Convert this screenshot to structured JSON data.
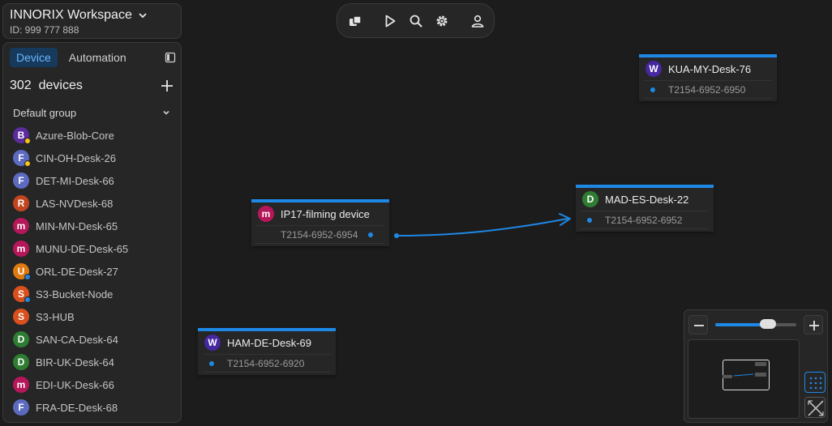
{
  "workspace": {
    "title": "INNORIX Workspace",
    "id_label": "ID: 999 777 888"
  },
  "sidebar": {
    "tabs": [
      {
        "label": "Device",
        "active": true
      },
      {
        "label": "Automation",
        "active": false
      }
    ],
    "devices_count_label": "302  devices",
    "group_label": "Default group",
    "devices": [
      {
        "letter": "B",
        "name": "Azure-Blob-Core",
        "color": "#5b2c9f",
        "status": "#f5c518"
      },
      {
        "letter": "F",
        "name": "CIN-OH-Desk-26",
        "color": "#5c6bc0",
        "status": "#f5c518"
      },
      {
        "letter": "F",
        "name": "DET-MI-Desk-66",
        "color": "#5c6bc0",
        "status": ""
      },
      {
        "letter": "R",
        "name": "LAS-NVDesk-68",
        "color": "#c1451f",
        "status": ""
      },
      {
        "letter": "m",
        "name": "MIN-MN-Desk-65",
        "color": "#b5175a",
        "status": ""
      },
      {
        "letter": "m",
        "name": "MUNU-DE-Desk-65",
        "color": "#b5175a",
        "status": ""
      },
      {
        "letter": "U",
        "name": "ORL-DE-Desk-27",
        "color": "#e07a10",
        "status": "#1e88e5"
      },
      {
        "letter": "S",
        "name": "S3-Bucket-Node",
        "color": "#d9501e",
        "status": "#1e88e5"
      },
      {
        "letter": "S",
        "name": "S3-HUB",
        "color": "#d9501e",
        "status": ""
      },
      {
        "letter": "D",
        "name": "SAN-CA-Desk-64",
        "color": "#2e7d32",
        "status": ""
      },
      {
        "letter": "D",
        "name": "BIR-UK-Desk-64",
        "color": "#2e7d32",
        "status": ""
      },
      {
        "letter": "m",
        "name": "EDI-UK-Desk-66",
        "color": "#b5175a",
        "status": ""
      },
      {
        "letter": "F",
        "name": "FRA-DE-Desk-68",
        "color": "#5c6bc0",
        "status": ""
      }
    ]
  },
  "toolbar": {
    "icons": [
      "layers-icon",
      "play-icon",
      "search-icon",
      "gear-icon",
      "user-icon"
    ]
  },
  "nodes": {
    "kua": {
      "letter": "W",
      "title": "KUA-MY-Desk-76",
      "port": "T2154-6952-6950",
      "color": "#4527a0"
    },
    "ip17": {
      "letter": "m",
      "title": "IP17-filming device",
      "port": "T2154-6952-6954",
      "color": "#b5175a"
    },
    "mad": {
      "letter": "D",
      "title": "MAD-ES-Desk-22",
      "port": "T2154-6952-6952",
      "color": "#2e7d32"
    },
    "ham": {
      "letter": "W",
      "title": "HAM-DE-Desk-69",
      "port": "T2154-6952-6920",
      "color": "#4527a0"
    }
  },
  "zoom": {
    "level": 0.65
  },
  "colors": {
    "accent": "#1e88e5",
    "background": "#1c1c1c",
    "panel": "#262626"
  }
}
